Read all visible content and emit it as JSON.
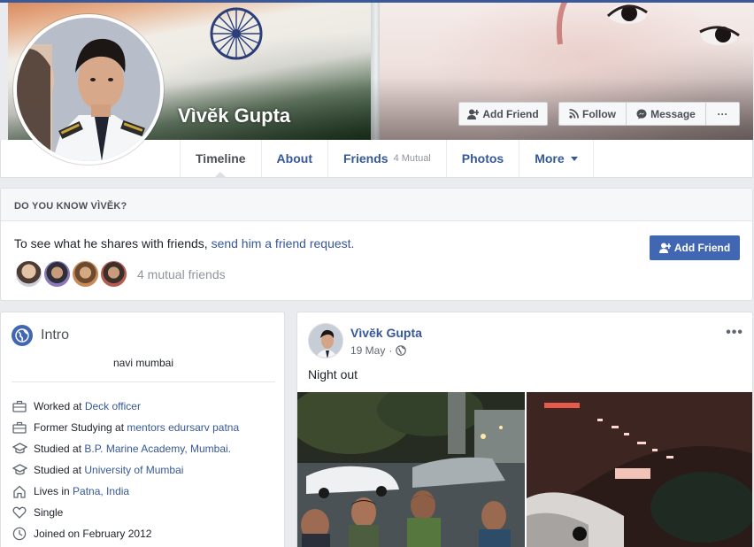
{
  "profile": {
    "name": "Vìvĕk Gupta",
    "buttons": {
      "add_friend": "Add Friend",
      "follow": "Follow",
      "message": "Message",
      "more_dots": "···"
    }
  },
  "nav": {
    "tabs": [
      {
        "label": "Timeline",
        "active": true
      },
      {
        "label": "About"
      },
      {
        "label": "Friends",
        "sub": "4 Mutual"
      },
      {
        "label": "Photos"
      },
      {
        "label": "More"
      }
    ]
  },
  "know": {
    "heading": "DO YOU KNOW VÌVĔK?",
    "text_prefix": "To see what he shares with friends,",
    "link": "send him a friend request.",
    "button": "Add Friend",
    "mutual": "4 mutual friends"
  },
  "intro": {
    "title": "Intro",
    "bio": "navi mumbai",
    "rows": [
      {
        "icon": "briefcase-icon",
        "text": "Worked at",
        "link": "Deck officer"
      },
      {
        "icon": "briefcase-icon",
        "text": "Former Studying at",
        "link": "mentors edursarv patna"
      },
      {
        "icon": "graduation-cap-icon",
        "text": "Studied at",
        "link": "B.P. Marine Academy, Mumbai."
      },
      {
        "icon": "graduation-cap-icon",
        "text": "Studied at",
        "link": "University of Mumbai"
      },
      {
        "icon": "home-icon",
        "text": "Lives in",
        "link": "Patna, India"
      },
      {
        "icon": "heart-icon",
        "text": "Single",
        "link": ""
      },
      {
        "icon": "clock-icon",
        "text": "Joined on February 2012",
        "link": ""
      }
    ]
  },
  "post": {
    "author": "Vìvĕk Gupta",
    "date": "19 May",
    "dot": "·",
    "menu": "•••",
    "text": "Night out"
  },
  "colors": {
    "brand": "#4267b2",
    "link": "#365899",
    "background": "#e9ebee"
  }
}
